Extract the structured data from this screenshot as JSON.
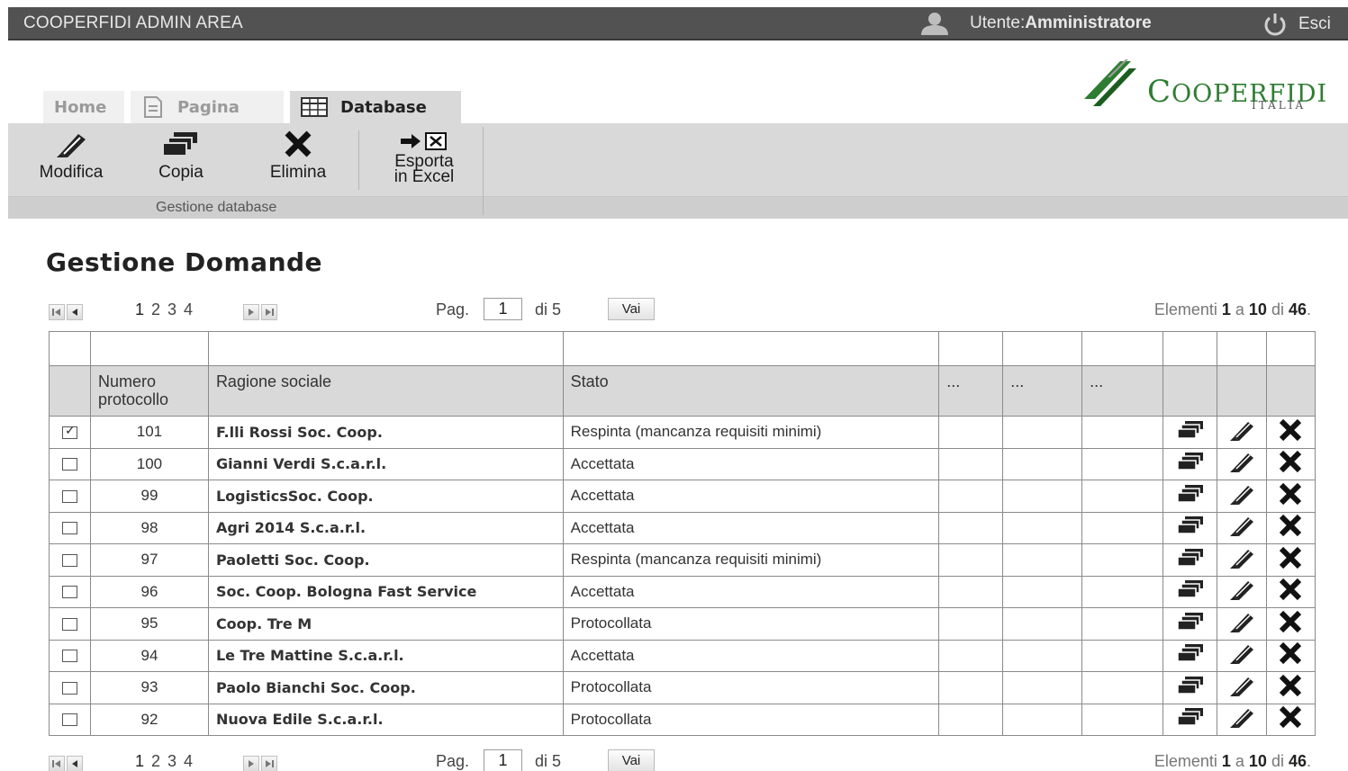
{
  "topbar": {
    "title": "COOPERFIDI ADMIN AREA",
    "user_label": "Utente: ",
    "user_name": "Amministratore",
    "logout": "Esci"
  },
  "logo": {
    "brand_first": "C",
    "brand_rest": "OOPERFIDI",
    "sub": "ITALIA",
    "color": "#2e7d32"
  },
  "tabs": {
    "home": "Home",
    "page": "Pagina",
    "database": "Database"
  },
  "ribbon": {
    "modifica": "Modifica",
    "copia": "Copia",
    "elimina": "Elimina",
    "esporta_line1": "Esporta",
    "esporta_line2": "in Excel",
    "group": "Gestione database"
  },
  "main": {
    "title": "Gestione Domande"
  },
  "pager": {
    "pages": [
      "1",
      "2",
      "3",
      "4"
    ],
    "pag_label": "Pag.",
    "current_page": "1",
    "of_label": "di 5",
    "go_button": "Vai",
    "count_prefix": "Elementi ",
    "count_from": "1",
    "count_a": " a ",
    "count_to": "10",
    "count_di": " di ",
    "count_total": "46",
    "count_dot": "."
  },
  "table": {
    "headers": {
      "numero": "Numero protocollo",
      "ragione": "Ragione sociale",
      "stato": "Stato",
      "extra1": "...",
      "extra2": "...",
      "extra3": "..."
    },
    "rows": [
      {
        "checked": true,
        "numero": "101",
        "ragione": "F.lli Rossi Soc. Coop.",
        "stato": "Respinta (mancanza requisiti minimi)"
      },
      {
        "checked": false,
        "numero": "100",
        "ragione": "Gianni Verdi S.c.a.r.l.",
        "stato": "Accettata"
      },
      {
        "checked": false,
        "numero": "99",
        "ragione": "LogisticsSoc. Coop.",
        "stato": "Accettata"
      },
      {
        "checked": false,
        "numero": "98",
        "ragione": "Agri 2014 S.c.a.r.l.",
        "stato": "Accettata"
      },
      {
        "checked": false,
        "numero": "97",
        "ragione": "Paoletti Soc. Coop.",
        "stato": "Respinta (mancanza requisiti minimi)"
      },
      {
        "checked": false,
        "numero": "96",
        "ragione": "Soc. Coop. Bologna Fast Service",
        "stato": "Accettata"
      },
      {
        "checked": false,
        "numero": "95",
        "ragione": "Coop. Tre M",
        "stato": "Protocollata"
      },
      {
        "checked": false,
        "numero": "94",
        "ragione": "Le Tre Mattine S.c.a.r.l.",
        "stato": "Accettata"
      },
      {
        "checked": false,
        "numero": "93",
        "ragione": "Paolo Bianchi Soc. Coop.",
        "stato": "Protocollata"
      },
      {
        "checked": false,
        "numero": "92",
        "ragione": "Nuova Edile S.c.a.r.l.",
        "stato": "Protocollata"
      }
    ],
    "row_actions": [
      "copy-icon",
      "edit-icon",
      "delete-icon"
    ]
  }
}
